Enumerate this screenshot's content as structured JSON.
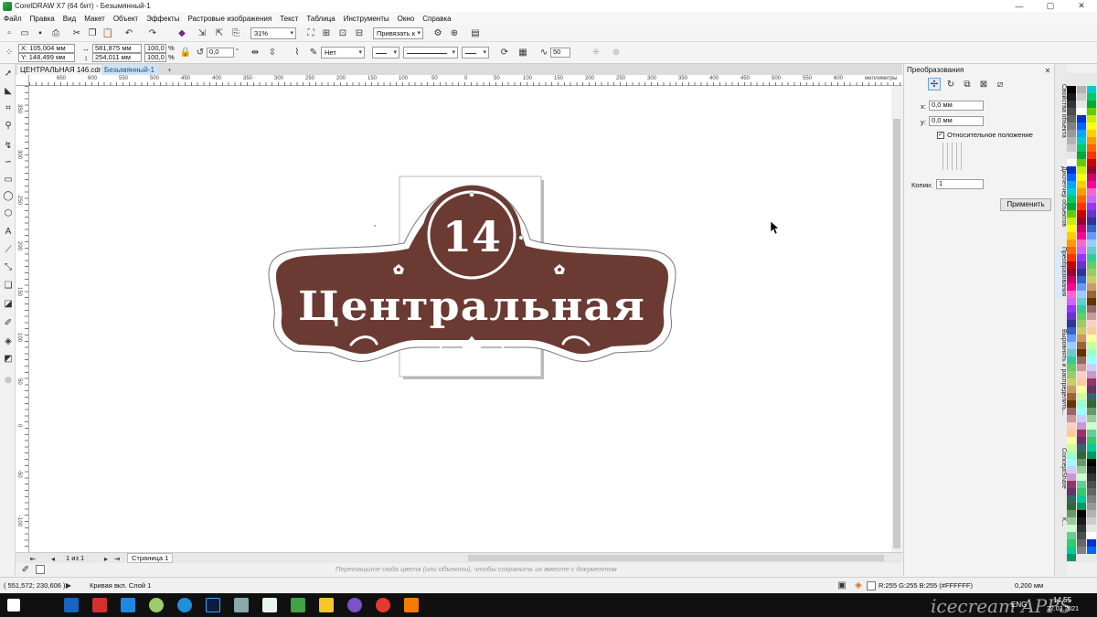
{
  "titlebar": {
    "title": "CorelDRAW X7 (64 бит) - Безымянный-1"
  },
  "menu": [
    "Файл",
    "Правка",
    "Вид",
    "Макет",
    "Объект",
    "Эффекты",
    "Растровые изображения",
    "Текст",
    "Таблица",
    "Инструменты",
    "Окно",
    "Справка"
  ],
  "toolbar": {
    "zoom": "31%",
    "snap": "Привязать к",
    "x": "X: 105,004 мм",
    "y": "Y: 148,499 мм",
    "w": "581,875 мм",
    "h": "254,011 мм",
    "sx": "100,0",
    "sy": "100,0",
    "pct1": "%",
    "pct2": "%",
    "angle": "0,0",
    "deg": "°",
    "outline": "Нет",
    "smooth": "50"
  },
  "tabs": {
    "file1": "ЦЕНТРАЛЬНАЯ 146.cdr",
    "file2": "Безымянный-1"
  },
  "ruler": {
    "h": [
      "650",
      "600",
      "550",
      "500",
      "450",
      "400",
      "350",
      "300",
      "250",
      "200",
      "150",
      "100",
      "50",
      "0",
      "50",
      "100",
      "150",
      "200",
      "250",
      "300",
      "350",
      "400",
      "450",
      "500",
      "550",
      "600",
      "650",
      "700"
    ],
    "unit": "миллиметры",
    "v": [
      "350",
      "300",
      "250",
      "200",
      "150",
      "100",
      "50",
      "0",
      "-50",
      "-100"
    ]
  },
  "sign": {
    "number": "14",
    "street": "Центральная"
  },
  "pagebar": {
    "pages": "1 из 1",
    "page_tab": "Страница 1"
  },
  "hint": "Перетащите сюда цвета (или объекты), чтобы сохранить их вместе с документом",
  "status": {
    "coords": "( 551,572; 230,606 )",
    "object": "Кривая вкл. Слой 1",
    "fill": "R:255 G:255 B:255 (#FFFFFF)",
    "hairline": "0,200 мм"
  },
  "docker": {
    "title": "Преобразования",
    "x_label": "x:",
    "x_value": "0,0 мм",
    "y_label": "y:",
    "y_value": "0,0 мм",
    "relative": "Относительное положение",
    "copies_label": "Копии:",
    "copies_value": "1",
    "apply": "Применить",
    "side_tabs": [
      "Свойства объекта",
      "Диспетчер объектов",
      "Преобразования",
      "Выровнять и распределить...",
      "ConceptShare",
      "К..."
    ]
  },
  "taskbar": {
    "lang": "ENG",
    "time": "14:55",
    "date": "22.03.2021",
    "watermark": "icecream APPS"
  },
  "colors": {
    "sign": "#6b3a33",
    "accent": "#1f8f3a"
  }
}
